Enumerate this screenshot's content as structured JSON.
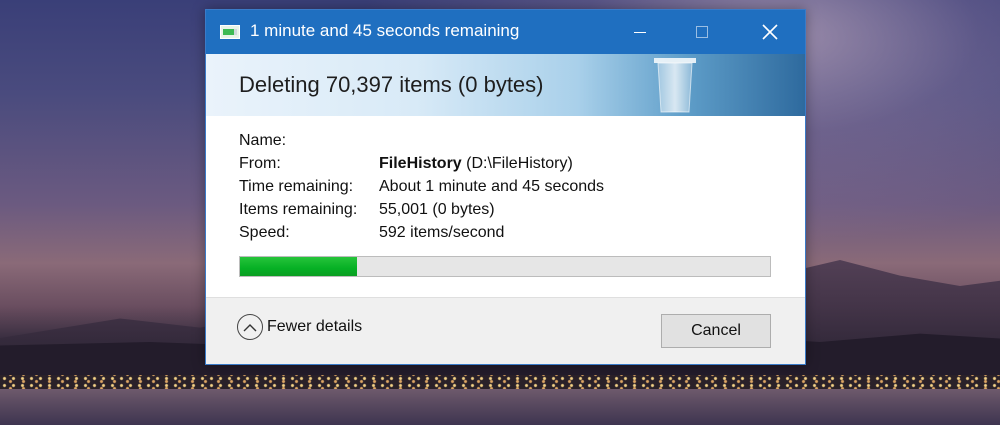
{
  "window": {
    "title": "1 minute and 45 seconds remaining",
    "icons": {
      "app": "copy-dialog-icon",
      "minimize": "minimize-icon",
      "maximize": "maximize-icon",
      "close": "close-icon"
    },
    "close_glyph": "✕"
  },
  "header": {
    "heading": "Deleting 70,397 items (0 bytes)",
    "icon": "recycle-bin-icon"
  },
  "details": {
    "name_label": "Name:",
    "name_value": "",
    "from_label": "From:",
    "from_bold": "FileHistory",
    "from_path": " (D:\\FileHistory)",
    "time_label": "Time remaining:",
    "time_value": "About 1 minute and 45 seconds",
    "items_label": "Items remaining:",
    "items_value": "55,001 (0 bytes)",
    "speed_label": "Speed:",
    "speed_value": "592 items/second"
  },
  "progress": {
    "fraction": 0.22,
    "color": "#06b025"
  },
  "footer": {
    "fewer_details": "Fewer details",
    "fewer_icon": "chevron-up-circle-icon",
    "cancel": "Cancel"
  },
  "colors": {
    "titlebar": "#1f6fc0",
    "accent": "#3a7bc8"
  }
}
